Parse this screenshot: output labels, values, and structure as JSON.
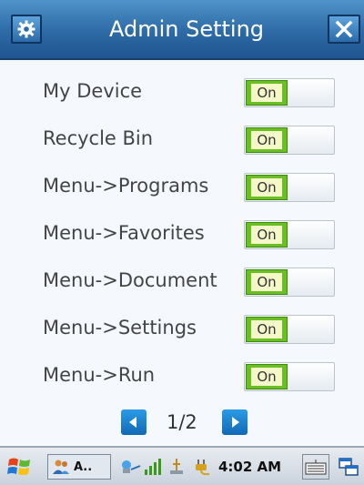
{
  "header": {
    "title": "Admin Setting",
    "settings_icon": "gear-icon",
    "close_icon": "close-icon"
  },
  "settings": [
    {
      "label": "My Device",
      "toggle": "On"
    },
    {
      "label": "Recycle Bin",
      "toggle": "On"
    },
    {
      "label": "Menu->Programs",
      "toggle": "On"
    },
    {
      "label": "Menu->Favorites",
      "toggle": "On"
    },
    {
      "label": "Menu->Document",
      "toggle": "On"
    },
    {
      "label": "Menu->Settings",
      "toggle": "On"
    },
    {
      "label": "Menu->Run",
      "toggle": "On"
    }
  ],
  "pager": {
    "text": "1/2",
    "prev_icon": "arrow-left-icon",
    "next_icon": "arrow-right-icon"
  },
  "taskbar": {
    "app_label": "A..",
    "time": "4:02 AM"
  },
  "colors": {
    "title_bar": "#2d6aa6",
    "toggle_on": "#6bbf22",
    "pager_button": "#1a7fd0"
  }
}
